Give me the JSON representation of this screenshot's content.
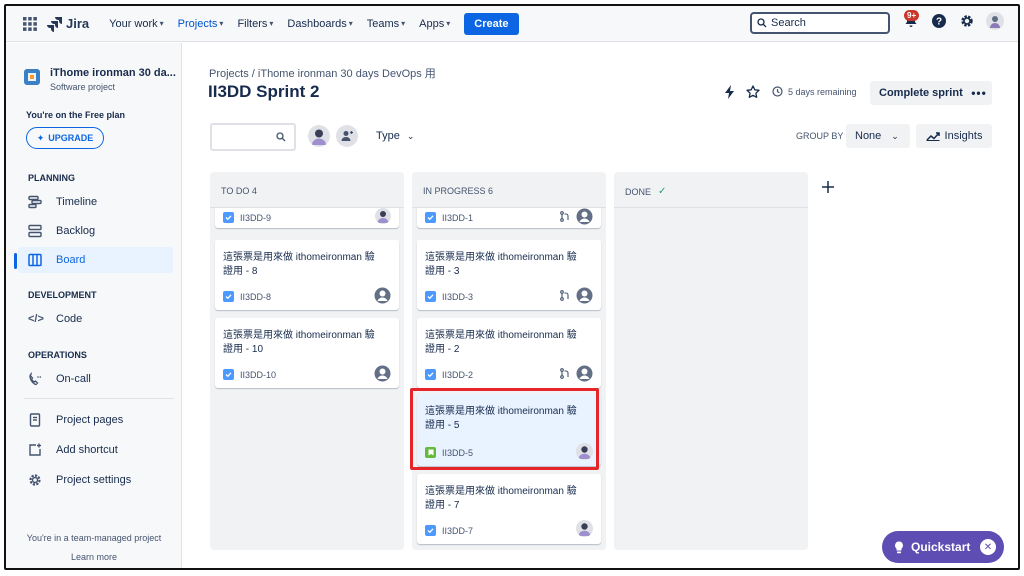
{
  "nav": {
    "product": "Jira",
    "items": [
      "Your work",
      "Projects",
      "Filters",
      "Dashboards",
      "Teams",
      "Apps"
    ],
    "create_label": "Create",
    "search_placeholder": "Search",
    "notification_count": "9+"
  },
  "sidebar": {
    "project_name": "iThome ironman 30 da...",
    "project_type": "Software project",
    "plan_text": "You're on the Free plan",
    "upgrade_label": "UPGRADE",
    "planning_header": "PLANNING",
    "planning_items": [
      "Timeline",
      "Backlog",
      "Board"
    ],
    "development_header": "DEVELOPMENT",
    "development_items": [
      "Code"
    ],
    "operations_header": "OPERATIONS",
    "operations_items": [
      "On-call"
    ],
    "bottom_items": [
      "Project pages",
      "Add shortcut",
      "Project settings"
    ],
    "team_text": "You're in a team-managed project",
    "learn_more": "Learn more"
  },
  "header": {
    "breadcrumb": "Projects  /  iThome ironman 30 days DevOps 用",
    "title": "II3DD Sprint 2",
    "remaining": "5 days remaining",
    "complete_label": "Complete sprint",
    "more_label": "•••"
  },
  "toolbar": {
    "type_label": "Type",
    "groupby_label": "GROUP BY",
    "groupby_value": "None",
    "insights_label": "Insights"
  },
  "columns": [
    {
      "title": "TO DO 4",
      "cards": [
        {
          "title": "",
          "key": "II3DD-9"
        },
        {
          "title": "這張票是用來做 ithomeironman 驗證用 - 8",
          "key": "II3DD-8"
        },
        {
          "title": "這張票是用來做 ithomeironman 驗證用 - 10",
          "key": "II3DD-10"
        }
      ]
    },
    {
      "title": "IN PROGRESS 6",
      "cards": [
        {
          "title": "",
          "key": "II3DD-1"
        },
        {
          "title": "這張票是用來做 ithomeironman 驗證用 - 3",
          "key": "II3DD-3"
        },
        {
          "title": "這張票是用來做 ithomeironman 驗證用 - 2",
          "key": "II3DD-2"
        },
        {
          "title": "這張票是用來做 ithomeironman 驗證用 - 5",
          "key": "II3DD-5"
        },
        {
          "title": "這張票是用來做 ithomeironman 驗證用 - 7",
          "key": "II3DD-7"
        }
      ]
    },
    {
      "title": "DONE",
      "cards": []
    }
  ],
  "quickstart_label": "Quickstart",
  "colors": {
    "accent": "#0c66e4",
    "highlight_border": "#e5252a",
    "quickstart_bg": "#5e4db2"
  }
}
